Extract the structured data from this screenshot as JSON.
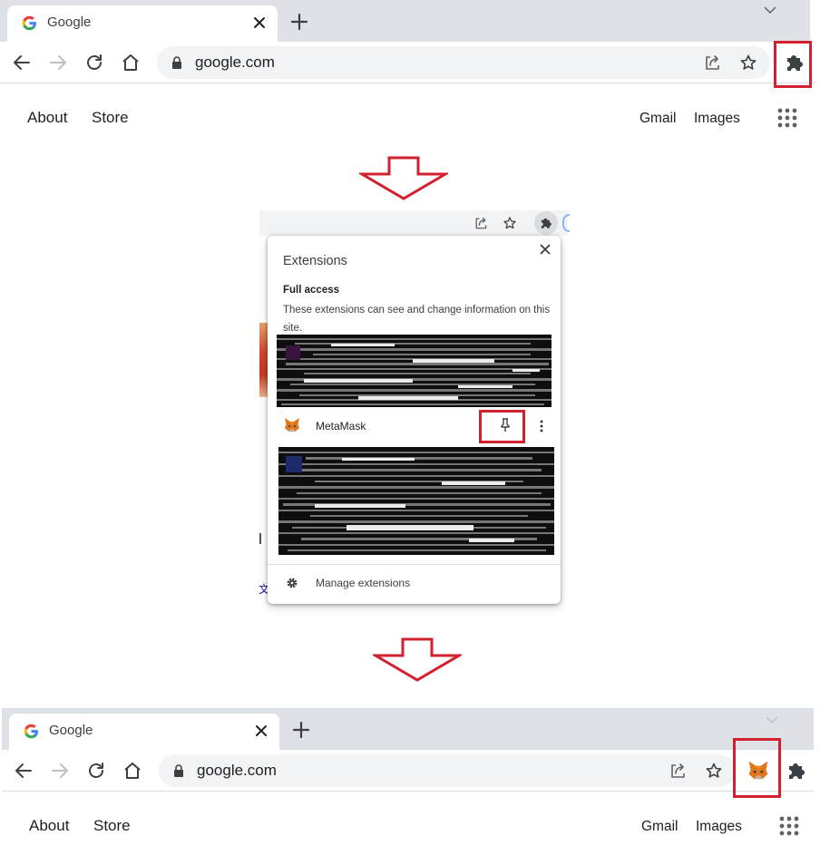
{
  "top_browser": {
    "tab": {
      "title": "Google"
    },
    "omnibox": {
      "url": "google.com"
    },
    "page_links": {
      "about": "About",
      "store": "Store",
      "gmail": "Gmail",
      "images": "Images"
    }
  },
  "extensions_popup": {
    "title": "Extensions",
    "section_title": "Full access",
    "section_desc": "These extensions can see and change information on this site.",
    "extension_name": "MetaMask",
    "manage_label": "Manage extensions",
    "background_glyph": "文"
  },
  "bottom_browser": {
    "tab": {
      "title": "Google"
    },
    "omnibox": {
      "url": "google.com"
    },
    "page_links": {
      "about": "About",
      "store": "Store",
      "gmail": "Gmail",
      "images": "Images"
    }
  },
  "colors": {
    "highlight": "#d3202f",
    "tabstrip": "#dee1e6",
    "omnibox": "#f1f3f4",
    "icon": "#5f6368"
  },
  "icons": [
    "google-g-icon",
    "close-icon",
    "plus-icon",
    "chevron-down-icon",
    "back-arrow-icon",
    "forward-arrow-icon",
    "reload-icon",
    "home-icon",
    "lock-icon",
    "share-icon",
    "star-icon",
    "puzzle-icon",
    "metamask-fox-icon",
    "pin-icon",
    "kebab-icon",
    "gear-icon",
    "apps-grid-icon",
    "down-arrow-icon"
  ]
}
